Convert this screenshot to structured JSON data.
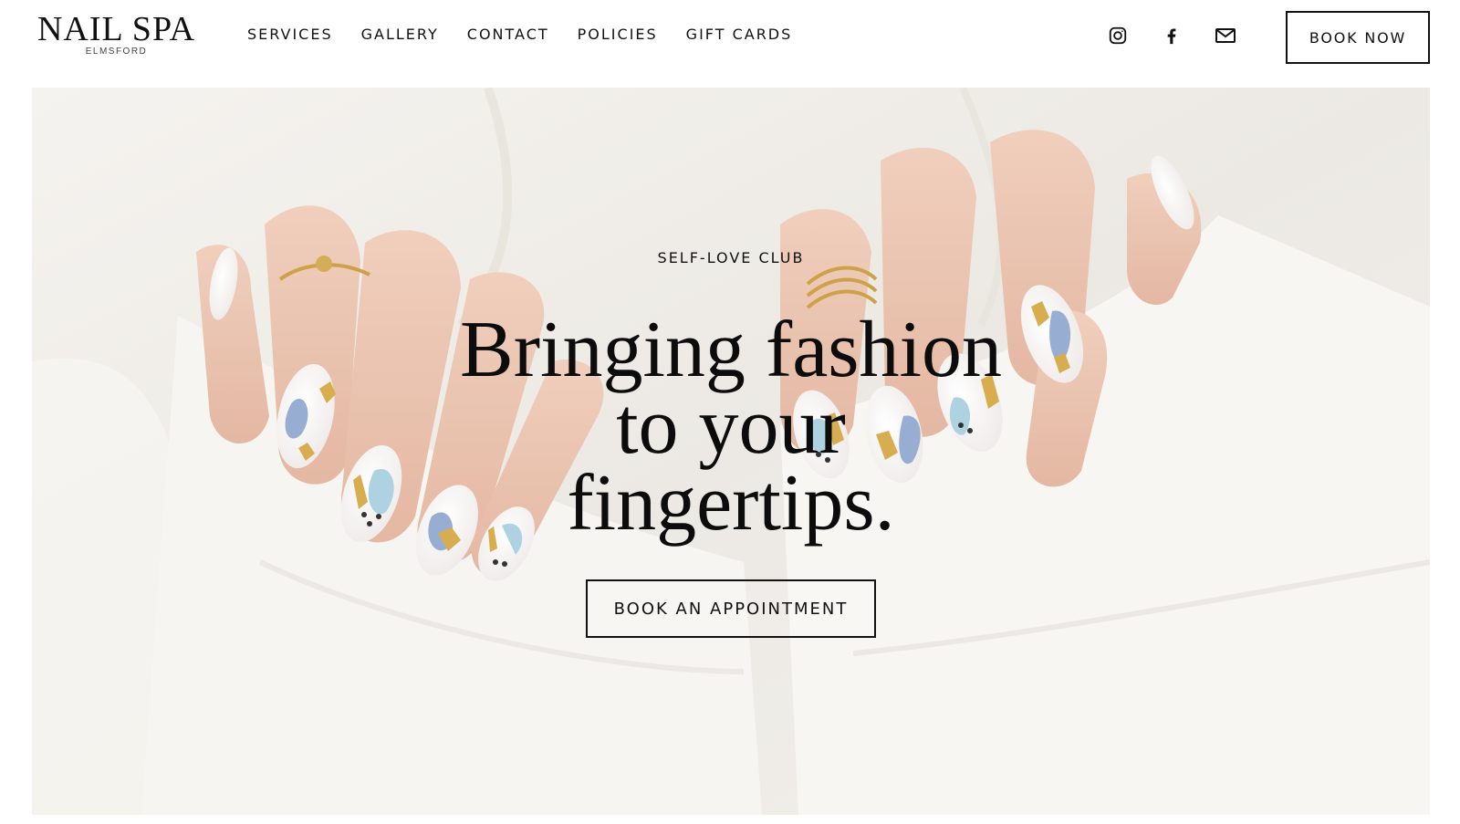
{
  "brand": {
    "name": "NAIL SPA",
    "location": "ELMSFORD"
  },
  "nav": {
    "items": [
      {
        "label": "SERVICES"
      },
      {
        "label": "GALLERY"
      },
      {
        "label": "CONTACT"
      },
      {
        "label": "POLICIES"
      },
      {
        "label": "GIFT CARDS"
      }
    ]
  },
  "socials": {
    "icons": [
      "instagram-icon",
      "facebook-icon",
      "email-icon"
    ]
  },
  "header": {
    "book_now_label": "BOOK NOW"
  },
  "hero": {
    "eyebrow": "SELF-LOVE CLUB",
    "headline_lines": [
      "Bringing fashion",
      "to your",
      "fingertips."
    ],
    "cta_label": "BOOK AN APPOINTMENT"
  },
  "colors": {
    "text": "#111111",
    "background": "#ffffff",
    "hero_fabric": "#efede8",
    "nail_blue": "#8fa6cf",
    "nail_gold": "#d4a640",
    "skin": "#e8bfa8"
  }
}
